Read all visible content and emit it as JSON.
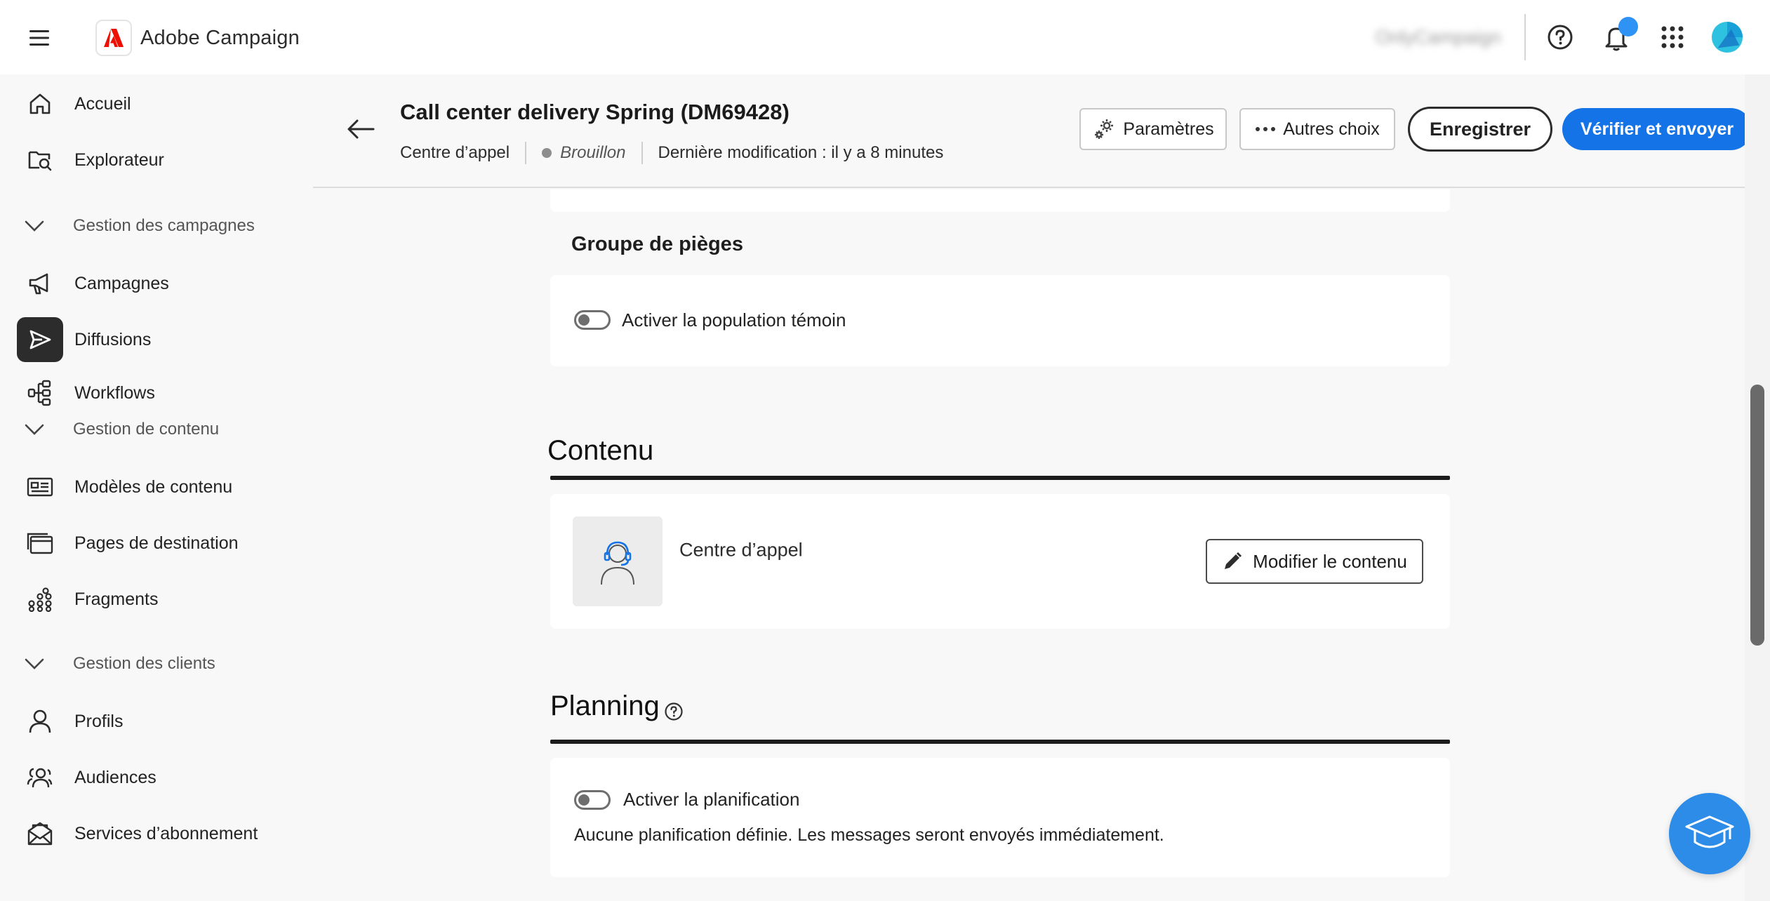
{
  "topbar": {
    "app_name": "Adobe Campaign",
    "org_name": "OnlyCampaign"
  },
  "sidebar": {
    "items": [
      {
        "label": "Accueil",
        "icon": "home-icon"
      },
      {
        "label": "Explorateur",
        "icon": "folder-search-icon"
      },
      {
        "group": "Gestion des campagnes"
      },
      {
        "label": "Campagnes",
        "icon": "megaphone-icon"
      },
      {
        "label": "Diffusions",
        "icon": "send-icon",
        "active": true
      },
      {
        "label": "Workflows",
        "icon": "workflow-icon"
      },
      {
        "group": "Gestion de contenu"
      },
      {
        "label": "Modèles de contenu",
        "icon": "content-template-icon"
      },
      {
        "label": "Pages de destination",
        "icon": "landing-page-icon"
      },
      {
        "label": "Fragments",
        "icon": "fragments-icon"
      },
      {
        "group": "Gestion des clients"
      },
      {
        "label": "Profils",
        "icon": "user-icon"
      },
      {
        "label": "Audiences",
        "icon": "audiences-icon"
      },
      {
        "label": "Services d’abonnement",
        "icon": "subscription-icon"
      }
    ]
  },
  "header": {
    "title": "Call center delivery Spring (DM69428)",
    "channel": "Centre d’appel",
    "status": "Brouillon",
    "last_modified": "Dernière modification : il y a 8 minutes",
    "params_label": "Paramètres",
    "more_label": "Autres choix",
    "save_label": "Enregistrer",
    "send_label": "Vérifier et envoyer"
  },
  "traps": {
    "title": "Groupe de pièges",
    "toggle_label": "Activer la population témoin"
  },
  "content": {
    "title": "Contenu",
    "item_name": "Centre d’appel",
    "edit_label": "Modifier le contenu"
  },
  "planning": {
    "title": "Planning",
    "toggle_label": "Activer la planification",
    "description": "Aucune planification définie. Les messages seront envoyés immédiatement."
  },
  "colors": {
    "accent": "#1473e6",
    "adobe_red": "#eb1000",
    "active_nav": "#2c2c2c",
    "fab": "#2d8ce8"
  }
}
